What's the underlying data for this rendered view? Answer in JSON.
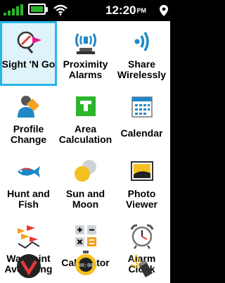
{
  "status": {
    "time": "12:20",
    "ampm": "PM",
    "signal_bars": 5,
    "battery_level": 1.0
  },
  "apps": [
    {
      "id": "sight-n-go",
      "label": "Sight 'N Go",
      "selected": true,
      "icon": "compass-arrow-icon"
    },
    {
      "id": "proximity-alarms",
      "label": "Proximity Alarms",
      "icon": "broadcast-tower-icon"
    },
    {
      "id": "share-wirelessly",
      "label": "Share Wirelessly",
      "icon": "wireless-waves-icon"
    },
    {
      "id": "profile-change",
      "label": "Profile Change",
      "icon": "profile-person-icon"
    },
    {
      "id": "area-calculation",
      "label": "Area Calculation",
      "icon": "area-square-icon"
    },
    {
      "id": "calendar",
      "label": "Calendar",
      "icon": "calendar-icon"
    },
    {
      "id": "hunt-and-fish",
      "label": "Hunt and Fish",
      "icon": "fish-icon"
    },
    {
      "id": "sun-and-moon",
      "label": "Sun and Moon",
      "icon": "sun-moon-icon"
    },
    {
      "id": "photo-viewer",
      "label": "Photo Viewer",
      "icon": "photo-icon"
    },
    {
      "id": "waypoint-averaging",
      "label": "Waypoint Averaging",
      "icon": "waypoint-flags-icon"
    },
    {
      "id": "calculator",
      "label": "Calculator",
      "icon": "calculator-icon"
    },
    {
      "id": "alarm-clock",
      "label": "Alarm Clock",
      "icon": "alarm-clock-icon"
    },
    {
      "id": "virb",
      "label": "",
      "icon": "virb-icon"
    },
    {
      "id": "stopwatch",
      "label": "",
      "icon": "stopwatch-icon"
    },
    {
      "id": "flashlight",
      "label": "",
      "icon": "flashlight-icon"
    }
  ],
  "colors": {
    "selected_border": "#29b6e8",
    "selected_bg": "#dff3fb",
    "status_green": "#2db52d"
  }
}
